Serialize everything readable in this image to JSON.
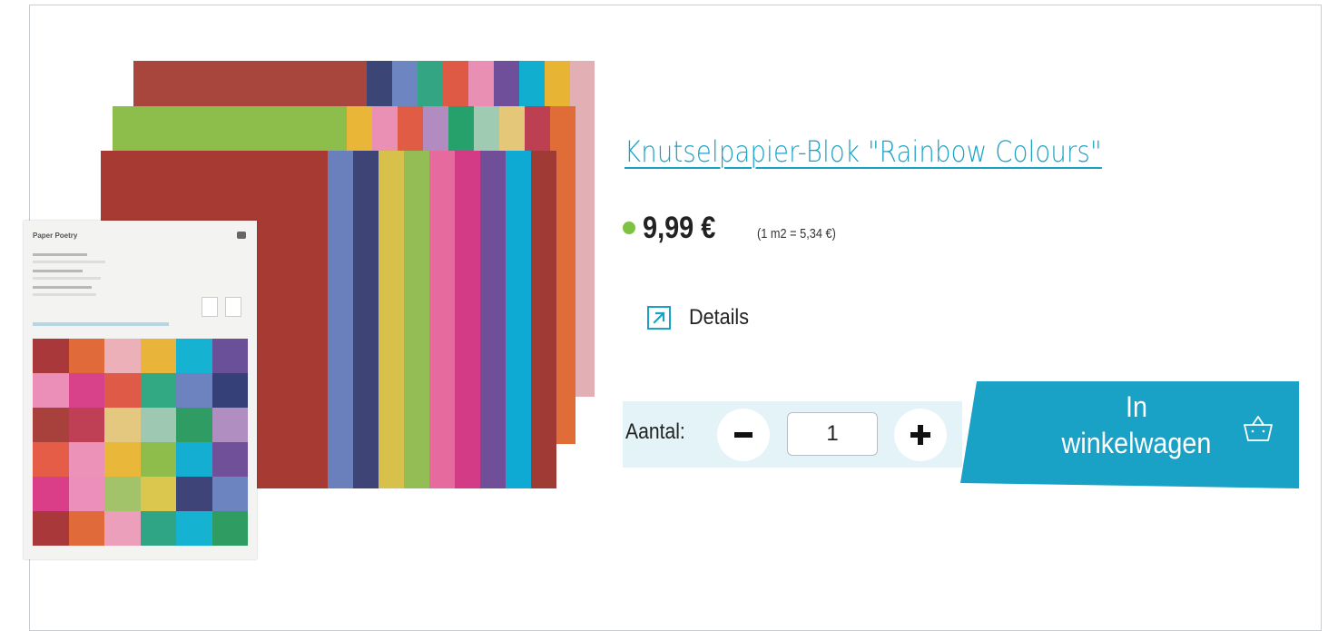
{
  "product": {
    "title": "Knutselpapier-Blok \"Rainbow Colours\"",
    "price": "9,99 €",
    "unit_price": "(1 m2 = 5,34 €)",
    "in_stock_color": "#7dc242",
    "image_alt": "Paper Poetry"
  },
  "details": {
    "label": "Details",
    "icon": "external-arrow-icon"
  },
  "quantity": {
    "label": "Aantal:",
    "value": "1",
    "minus_icon": "minus-icon",
    "plus_icon": "plus-icon"
  },
  "cart": {
    "label_line1": "In",
    "label_line2": "winkelwagen",
    "icon": "shopping-basket-icon",
    "color": "#1aa1c6"
  },
  "colors": {
    "accent": "#1aa1c6",
    "quantity_band": "#e3f3f8",
    "border": "#c8cdd2"
  }
}
